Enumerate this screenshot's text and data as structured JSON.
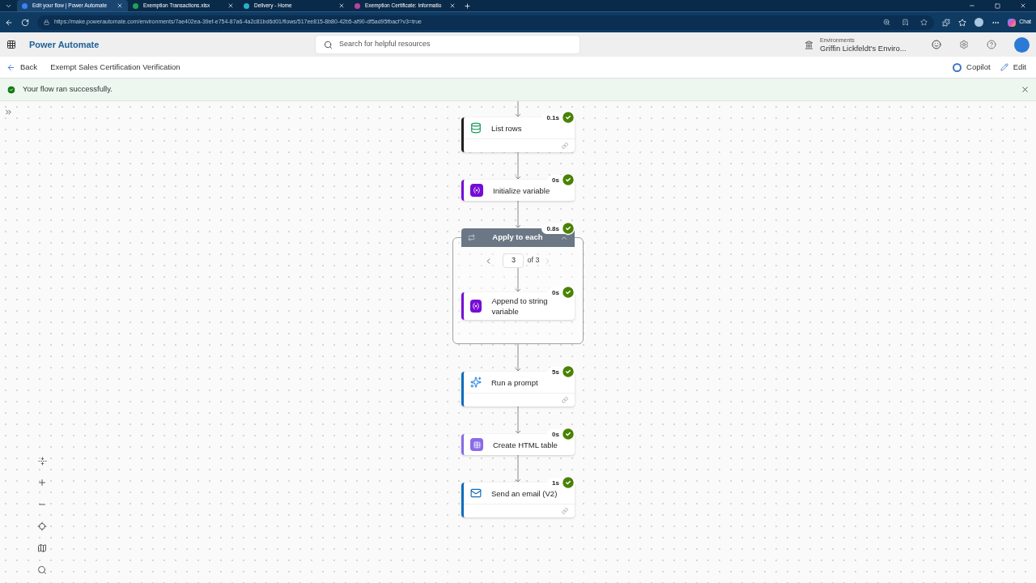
{
  "browser": {
    "tabs": [
      {
        "title": "Edit your flow | Power Automate",
        "selected": true,
        "color": "#3b82f6"
      },
      {
        "title": "Exemption Transactions.xlsx",
        "selected": false,
        "color": "#22a355"
      },
      {
        "title": "Delivery - Home",
        "selected": false,
        "color": "#2bb0c8"
      },
      {
        "title": "Exemption Certificate: Informatio",
        "selected": false,
        "color": "#c03fa0"
      }
    ],
    "url": "https://make.powerautomate.com/environments/7ae402ea-39ef-e754-87a6-4a2c81bd6d01/flows/517ee815-8b80-42b5-af90-df5ad95fbacf?v3=true",
    "chat": "Chat"
  },
  "app": {
    "name": "Power Automate",
    "search_placeholder": "Search for helpful resources",
    "environment_label": "Environments",
    "environment_name": "Griffin Lickfeldt's Enviro..."
  },
  "toolbar": {
    "back": "Back",
    "flow_title": "Exempt Sales Certification Verification",
    "copilot": "Copilot",
    "edit": "Edit"
  },
  "banner": {
    "message": "Your flow ran successfully."
  },
  "flow": {
    "steps": [
      {
        "kind": "dataverse",
        "title": "List rows",
        "duration": "0.1s",
        "succeeded": true,
        "color": "#1f1f1f",
        "footer": true
      },
      {
        "kind": "variable",
        "title": "Initialize variable",
        "duration": "0s",
        "succeeded": true,
        "color": "#770bd6",
        "footer": false
      },
      {
        "kind": "loop",
        "title": "Apply to each",
        "duration": "0.8s",
        "succeeded": true,
        "expanded": true,
        "page": "3",
        "page_total": "of 3",
        "children": [
          {
            "kind": "variable",
            "title": "Append to string variable",
            "duration": "0s",
            "succeeded": true,
            "color": "#770bd6",
            "footer": false
          }
        ]
      },
      {
        "kind": "ai",
        "title": "Run a prompt",
        "duration": "5s",
        "succeeded": true,
        "color": "#0f6cbd",
        "footer": true
      },
      {
        "kind": "html",
        "title": "Create HTML table",
        "duration": "0s",
        "succeeded": true,
        "color": "#8a6be8",
        "footer": false
      },
      {
        "kind": "outlook",
        "title": "Send an email (V2)",
        "duration": "1s",
        "succeeded": true,
        "color": "#0f6cbd",
        "footer": true
      }
    ]
  }
}
